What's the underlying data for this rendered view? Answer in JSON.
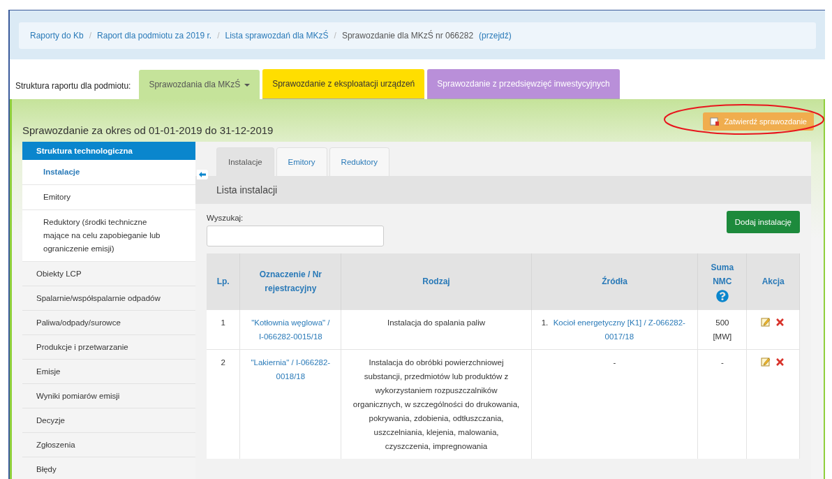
{
  "breadcrumb": {
    "separator": "/",
    "items": [
      {
        "label": "Raporty do Kb"
      },
      {
        "label": "Raport dla podmiotu za 2019 r."
      },
      {
        "label": "Lista sprawozdań dla MKzŚ"
      }
    ],
    "current": "Sprawozdanie dla MKzŚ nr 066282",
    "current_link": "(przejdź)"
  },
  "report_structure": {
    "label": "Struktura raportu dla podmiotu:",
    "tabs": [
      {
        "label": "Sprawozdania dla MKzŚ",
        "color": "#c5e39a",
        "selected": true,
        "dropdown": true
      },
      {
        "label": "Sprawozdanie z eksploatacji urządzeń",
        "color": "#ffde00",
        "selected": false,
        "dropdown": false
      },
      {
        "label": "Sprawozdanie z przedsięwzięć inwestycyjnych",
        "color": "#b98fd9",
        "selected": false,
        "dropdown": false
      }
    ]
  },
  "period_title": "Sprawozdanie za okres od 01-01-2019 do 31-12-2019",
  "approve_button": {
    "label": "Zatwierdź sprawozdanie",
    "highlighted": true
  },
  "sidebar": {
    "items": [
      {
        "label": "Struktura technologiczna",
        "selected": true,
        "children": [
          {
            "label": "Instalacje",
            "selected": true
          },
          {
            "label": "Emitory",
            "selected": false
          },
          {
            "label": "Reduktory (środki techniczne mające na celu zapobieganie lub ograniczenie emisji)",
            "selected": false
          }
        ]
      },
      {
        "label": "Obiekty LCP",
        "selected": false
      },
      {
        "label": "Spalarnie/współspalarnie odpadów",
        "selected": false
      },
      {
        "label": "Paliwa/odpady/surowce",
        "selected": false
      },
      {
        "label": "Produkcje i przetwarzanie",
        "selected": false
      },
      {
        "label": "Emisje",
        "selected": false
      },
      {
        "label": "Wyniki pomiarów emisji",
        "selected": false
      },
      {
        "label": "Decyzje",
        "selected": false
      },
      {
        "label": "Zgłoszenia",
        "selected": false
      },
      {
        "label": "Błędy",
        "selected": false
      }
    ]
  },
  "tabs": [
    {
      "label": "Instalacje",
      "selected": true
    },
    {
      "label": "Emitory",
      "selected": false
    },
    {
      "label": "Reduktory",
      "selected": false
    }
  ],
  "panel_title": "Lista instalacji",
  "search": {
    "label": "Wyszukaj:"
  },
  "add_button": "Dodaj instalację",
  "table": {
    "columns": [
      {
        "label": "Lp.",
        "help": false
      },
      {
        "label": "Oznaczenie / Nr rejestracyjny",
        "help": false
      },
      {
        "label": "Rodzaj",
        "help": false
      },
      {
        "label": "Źródła",
        "help": false
      },
      {
        "label": "Suma NMC",
        "help": true
      },
      {
        "label": "Akcja",
        "help": false
      }
    ],
    "rows": [
      {
        "lp": "1",
        "designation": "\"Kotłownia węglowa\" / I-066282-0015/18",
        "type": "Instalacja do spalania paliw",
        "sources": [
          {
            "number": "1.",
            "link": "Kocioł energetyczny [K1] / Z-066282-0017/18"
          }
        ],
        "nmc": "500 [MW]"
      },
      {
        "lp": "2",
        "designation": "\"Lakiernia\" / I-066282-0018/18",
        "type": "Instalacja do obróbki powierzchniowej substancji, przedmiotów lub produktów z wykorzystaniem rozpuszczalników organicznych, w szczególności do drukowania, pokrywania, zdobienia, odtłuszczania, uszczelniania, klejenia, malowania, czyszczenia, impregnowania",
        "sources_text": "-",
        "nmc": "-"
      }
    ]
  }
}
